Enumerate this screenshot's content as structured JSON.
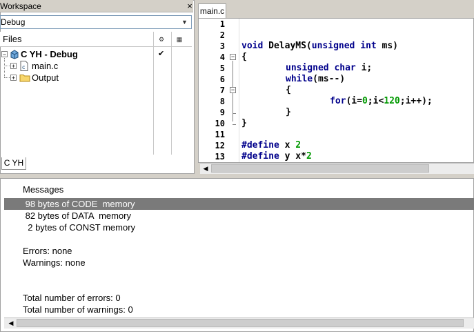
{
  "workspace": {
    "title": "Workspace",
    "close_glyph": "×",
    "configuration": "Debug",
    "files_header": "Files",
    "col_icon1": "⚙",
    "col_icon2": "▦",
    "project": {
      "name": "C YH - Debug",
      "check": "✔"
    },
    "items": [
      {
        "label": "main.c",
        "icon": "c-file-icon"
      },
      {
        "label": "Output",
        "icon": "folder-icon"
      }
    ],
    "tab": "C YH"
  },
  "editor": {
    "tab": "main.c",
    "line_numbers": [
      "1",
      "2",
      "3",
      "4",
      "5",
      "6",
      "7",
      "8",
      "9",
      "10",
      "11",
      "12",
      "13"
    ],
    "lines": {
      "l3": {
        "kw1": "void",
        "t1": " DelayMS(",
        "kw2": "unsigned",
        "t2": " ",
        "kw3": "int",
        "t3": " ms)"
      },
      "l4": "{",
      "l5": {
        "kw1": "unsigned",
        "t1": " ",
        "kw2": "char",
        "t2": " i;"
      },
      "l6": {
        "kw1": "while",
        "t1": "(ms--)"
      },
      "l7": "{",
      "l8": {
        "kw1": "for",
        "t1": "(i=",
        "n1": "0",
        "t2": ";i<",
        "n2": "120",
        "t3": ";i++);"
      },
      "l9": "}",
      "l10": "}",
      "l12": {
        "kw1": "#define",
        "t1": " x ",
        "n1": "2"
      },
      "l13": {
        "kw1": "#define",
        "t1": " y x*",
        "n1": "2"
      }
    }
  },
  "messages": {
    "header": "Messages",
    "rows": [
      " 98 bytes of CODE  memory",
      " 82 bytes of DATA  memory",
      "  2 bytes of CONST memory",
      "Errors: none",
      "Warnings: none",
      "Total number of errors: 0",
      "Total number of warnings: 0"
    ]
  },
  "colors": {
    "keyword": "#00008b",
    "number": "#009900",
    "selection": "#7a7a7a"
  }
}
